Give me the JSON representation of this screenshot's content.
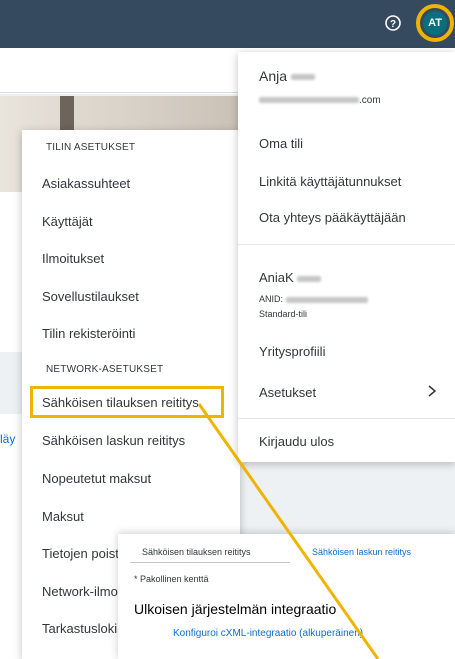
{
  "header": {
    "help_icon": "question-circle-icon",
    "avatar_initials": "AT",
    "avatar_color": "#0a6e7c",
    "highlight_color": "#f0b400"
  },
  "background": {
    "partial_link": "läy"
  },
  "left_menu": {
    "section1_title": "TILIN ASETUKSET",
    "section1_items": [
      "Asiakassuhteet",
      "Käyttäjät",
      "Ilmoitukset",
      "Sovellustilaukset",
      "Tilin rekisteröinti"
    ],
    "section2_title": "NETWORK-ASETUKSET",
    "section2_items": [
      "Sähköisen tilauksen reititys",
      "Sähköisen laskun reititys",
      "Nopeutetut maksut",
      "Maksut",
      "Tietojen poist",
      "Network-ilmo",
      "Tarkastusloki"
    ]
  },
  "user_menu": {
    "name": "Anja",
    "email_suffix": ".com",
    "items": [
      "Oma tili",
      "Linkitä käyttäjätunnukset",
      "Ota yhteys pääkäyttäjään"
    ],
    "account_name": "AniaK",
    "anid_label": "ANID:",
    "account_type": "Standard-tili",
    "company_profile": "Yritysprofiili",
    "settings": "Asetukset",
    "logout": "Kirjaudu ulos"
  },
  "dialog": {
    "tab_active": "Sähköisen tilauksen reititys",
    "tab_other": "Sähköisen laskun reititys",
    "required_note": "* Pakollinen kenttä",
    "title": "Ulkoisen järjestelmän integraatio",
    "link": "Konfiguroi cXML-integraatio (alkuperäinen)"
  }
}
